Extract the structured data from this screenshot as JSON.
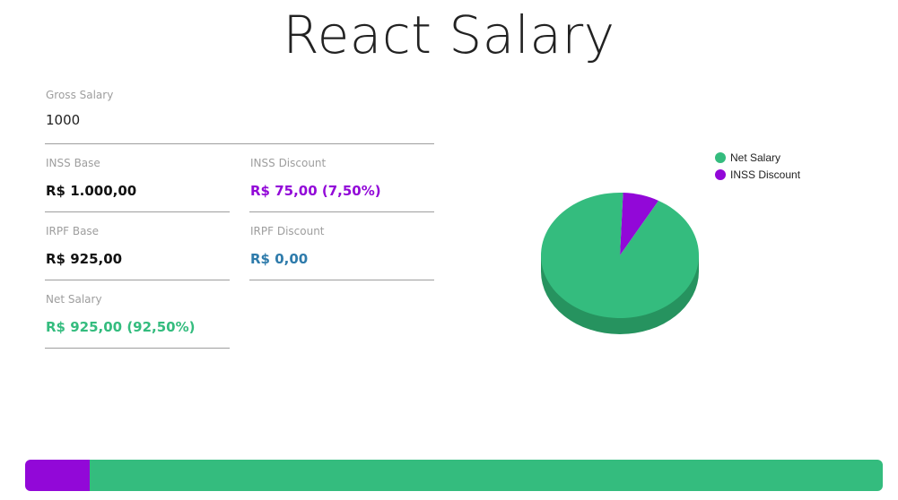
{
  "app": {
    "title": "React Salary"
  },
  "form": {
    "gross_salary": {
      "label": "Gross Salary",
      "value": "1000"
    },
    "inss_base": {
      "label": "INSS Base",
      "value": "R$ 1.000,00"
    },
    "inss_discount": {
      "label": "INSS Discount",
      "value": "R$ 75,00 (7,50%)"
    },
    "irpf_base": {
      "label": "IRPF Base",
      "value": "R$ 925,00"
    },
    "irpf_discount": {
      "label": "IRPF Discount",
      "value": "R$ 0,00"
    },
    "net_salary": {
      "label": "Net Salary",
      "value": "R$ 925,00 (92,50%)"
    }
  },
  "colors": {
    "net_salary": "#34bc7e",
    "net_salary_dark": "#26935f",
    "inss": "#9208d8",
    "inss_dark": "#6a05a0",
    "irpf": "#2e7bab",
    "label": "#9e9e9e",
    "text": "#222222"
  },
  "chart_data": {
    "type": "pie",
    "labels": [
      "Net Salary",
      "INSS Discount"
    ],
    "values": [
      92.5,
      7.5
    ],
    "legend_position": "top-right"
  },
  "progress_bar": {
    "segments": [
      {
        "name": "INSS Discount",
        "percent": 7.5
      },
      {
        "name": "IRPF Discount",
        "percent": 0
      },
      {
        "name": "Net Salary",
        "percent": 92.5
      }
    ]
  }
}
